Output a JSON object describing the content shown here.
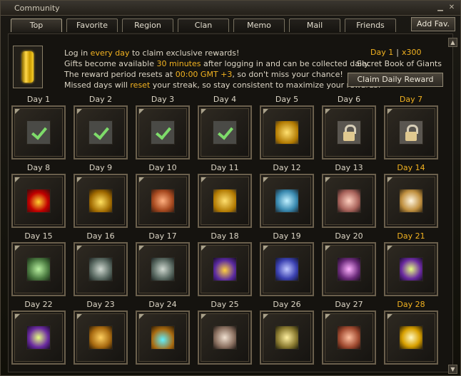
{
  "window": {
    "title": "Community",
    "minimize_icon": "minimize-icon",
    "close_icon": "close-icon"
  },
  "tabs": [
    {
      "label": "Top",
      "active": true
    },
    {
      "label": "Favorite",
      "active": false
    },
    {
      "label": "Region",
      "active": false
    },
    {
      "label": "Clan",
      "active": false
    },
    {
      "label": "Memo",
      "active": false
    },
    {
      "label": "Mail",
      "active": false
    },
    {
      "label": "Friends",
      "active": false
    }
  ],
  "add_fav_label": "Add Fav.",
  "info": {
    "line1_pre": "Log in ",
    "line1_hl": "every day",
    "line1_post": " to claim exclusive rewards!",
    "line2_pre": "Gifts become available ",
    "line2_hl": "30 minutes",
    "line2_post": " after logging in and can be collected daily.",
    "line3_pre": "The reward period resets at ",
    "line3_hl": "00:00 GMT +3",
    "line3_post": ", so don't miss your chance!",
    "line4_pre": "Missed days will ",
    "line4_hl": "reset",
    "line4_post": " your streak, so stay consistent to maximize your rewards!"
  },
  "reward": {
    "day": "Day 1",
    "separator": "|",
    "qty": "x300",
    "name": "Secret Book of Giants",
    "claim_label": "Claim Daily Reward"
  },
  "colors": {
    "highlight": "#f2b220",
    "text": "#ddd6c6"
  },
  "days": [
    {
      "label": "Day 1",
      "icon": "check-icon",
      "gold": false
    },
    {
      "label": "Day 2",
      "icon": "check-icon",
      "gold": false
    },
    {
      "label": "Day 3",
      "icon": "check-icon",
      "gold": false
    },
    {
      "label": "Day 4",
      "icon": "check-icon",
      "gold": false
    },
    {
      "label": "Day 5",
      "icon": "gold-pouch-icon",
      "gold": false
    },
    {
      "label": "Day 6",
      "icon": "lock-icon",
      "gold": false
    },
    {
      "label": "Day 7",
      "icon": "lock-icon",
      "gold": true
    },
    {
      "label": "Day 8",
      "icon": "red-crown-icon",
      "gold": false
    },
    {
      "label": "Day 9",
      "icon": "gold-crown-icon",
      "gold": false
    },
    {
      "label": "Day 10",
      "icon": "copper-ore-icon",
      "gold": false
    },
    {
      "label": "Day 11",
      "icon": "gold-coin-icon",
      "gold": false
    },
    {
      "label": "Day 12",
      "icon": "blue-book-icon",
      "gold": false
    },
    {
      "label": "Day 13",
      "icon": "pink-book-icon",
      "gold": false
    },
    {
      "label": "Day 14",
      "icon": "gift-box-icon",
      "gold": true
    },
    {
      "label": "Day 15",
      "icon": "green-book-icon",
      "gold": false
    },
    {
      "label": "Day 16",
      "icon": "grey-book-icon",
      "gold": false
    },
    {
      "label": "Day 17",
      "icon": "grey-book-icon",
      "gold": false
    },
    {
      "label": "Day 18",
      "icon": "purple-crown-icon",
      "gold": false
    },
    {
      "label": "Day 19",
      "icon": "blue-cube-icon",
      "gold": false
    },
    {
      "label": "Day 20",
      "icon": "weapon-icon",
      "gold": false
    },
    {
      "label": "Day 21",
      "icon": "mask-icon",
      "gold": true
    },
    {
      "label": "Day 22",
      "icon": "mask-icon",
      "gold": false
    },
    {
      "label": "Day 23",
      "icon": "chest-icon",
      "gold": false
    },
    {
      "label": "Day 24",
      "icon": "gem-chest-icon",
      "gold": false
    },
    {
      "label": "Day 25",
      "icon": "scroll-icon",
      "gold": false
    },
    {
      "label": "Day 26",
      "icon": "gold-scroll-icon",
      "gold": false
    },
    {
      "label": "Day 27",
      "icon": "red-scroll-icon",
      "gold": false
    },
    {
      "label": "Day 28",
      "icon": "diamond-icon",
      "gold": true
    }
  ]
}
